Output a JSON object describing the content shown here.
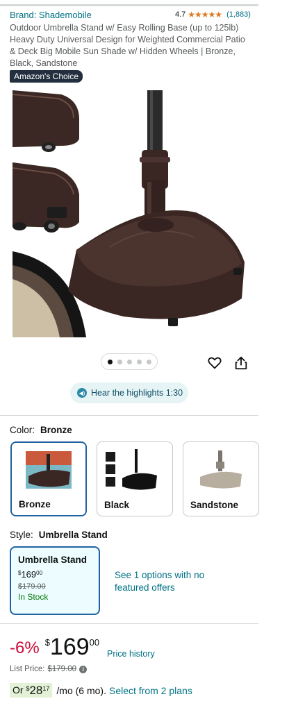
{
  "header": {
    "brand": "Brand: Shademobile",
    "rating_score": "4.7",
    "rating_stars": "★★★★★",
    "rating_count": "(1,883)",
    "title": "Outdoor Umbrella Stand w/ Easy Rolling Base (up to 125lb) Heavy Duty Universal Design for Weighted Commercial Patio & Deck Big Mobile Sun Shade w/ Hidden Wheels | Bronze, Black, Sandstone",
    "badge": "Amazon's Choice"
  },
  "gallery": {
    "image_count": 5,
    "active_index": 0
  },
  "actions": {
    "heart_icon": "heart-icon",
    "share_icon": "share-icon"
  },
  "highlights": {
    "label": "Hear the highlights 1:30",
    "icon": "speaker-icon"
  },
  "color": {
    "label": "Color:",
    "selected": "Bronze",
    "options": [
      {
        "label": "Bronze",
        "selected": true
      },
      {
        "label": "Black",
        "selected": false
      },
      {
        "label": "Sandstone",
        "selected": false
      }
    ]
  },
  "style": {
    "label": "Style:",
    "selected": "Umbrella Stand",
    "card": {
      "name": "Umbrella Stand",
      "price_symbol": "$",
      "price_whole": "169",
      "price_frac": "00",
      "list_price": "$179.00",
      "stock": "In Stock"
    },
    "see_options": "See 1 options with no featured offers"
  },
  "pricing": {
    "discount": "-6%",
    "symbol": "$",
    "whole": "169",
    "fraction": "00",
    "price_history": "Price history",
    "list_label": "List Price:",
    "list_value": "$179.00",
    "plan_prefix": "Or",
    "plan_symbol": "$",
    "plan_whole": "28",
    "plan_frac": "17",
    "plan_suffix": "/mo (6 mo).",
    "plan_link": "Select from 2 plans"
  },
  "colors": {
    "link": "#007185",
    "star": "#de7921",
    "discount": "#cc0c39",
    "selected_border": "#2162a1",
    "in_stock": "#007600",
    "plan_chip": "#e3f1d6",
    "bronze": "#3a2622"
  }
}
